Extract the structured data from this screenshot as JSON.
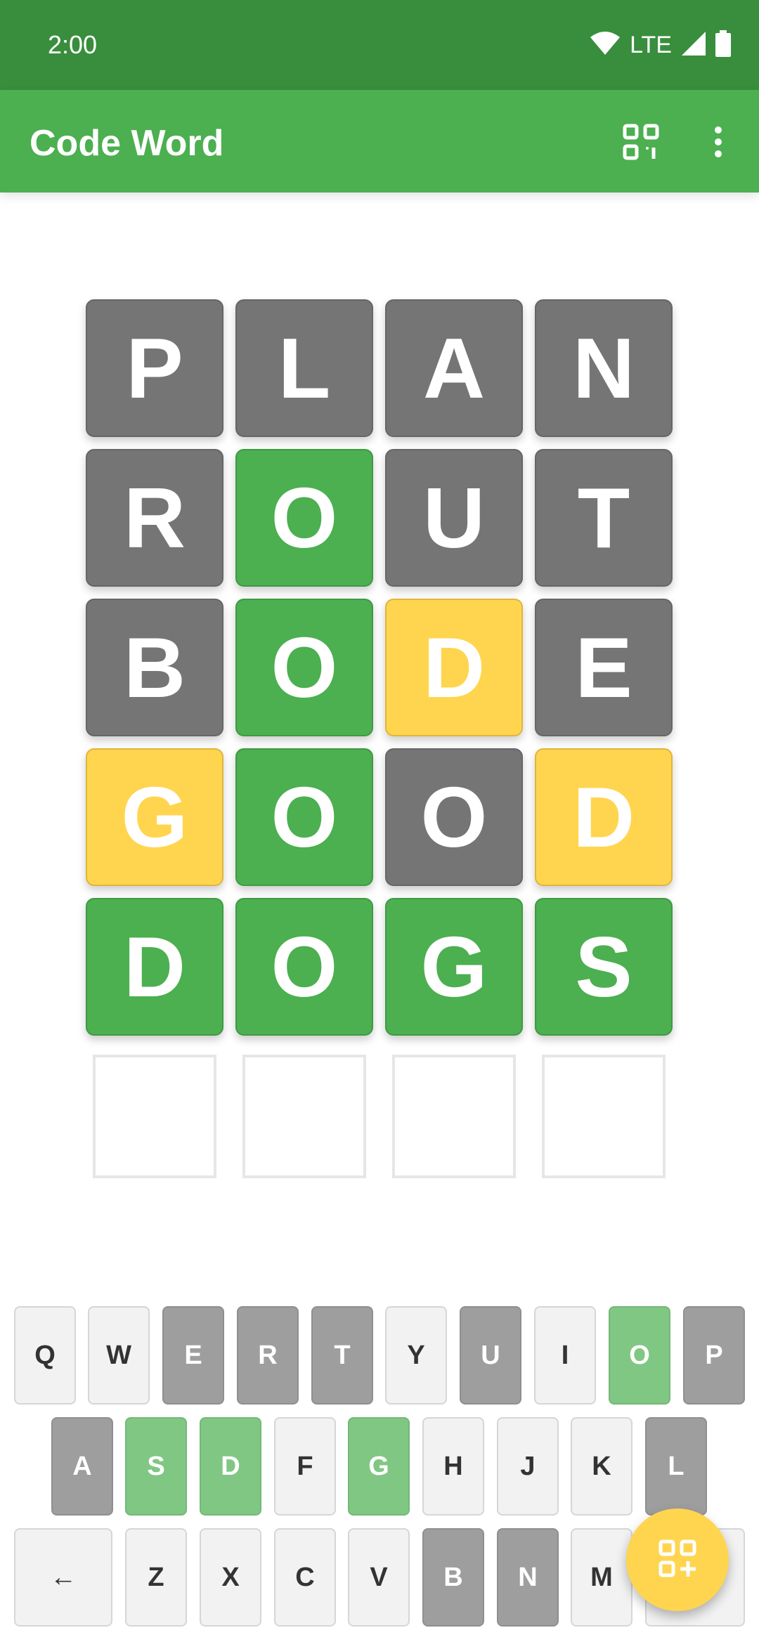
{
  "status_bar": {
    "time": "2:00",
    "network": "LTE",
    "icons": [
      "wifi-icon",
      "cell-signal-icon",
      "battery-icon"
    ]
  },
  "app_bar": {
    "title": "Code Word",
    "actions": [
      "grid-view-icon",
      "more-vert-icon"
    ]
  },
  "board": {
    "rows": [
      [
        {
          "letter": "P",
          "state": "absent"
        },
        {
          "letter": "L",
          "state": "absent"
        },
        {
          "letter": "A",
          "state": "absent"
        },
        {
          "letter": "N",
          "state": "absent"
        }
      ],
      [
        {
          "letter": "R",
          "state": "absent"
        },
        {
          "letter": "O",
          "state": "correct"
        },
        {
          "letter": "U",
          "state": "absent"
        },
        {
          "letter": "T",
          "state": "absent"
        }
      ],
      [
        {
          "letter": "B",
          "state": "absent"
        },
        {
          "letter": "O",
          "state": "correct"
        },
        {
          "letter": "D",
          "state": "present"
        },
        {
          "letter": "E",
          "state": "absent"
        }
      ],
      [
        {
          "letter": "G",
          "state": "present"
        },
        {
          "letter": "O",
          "state": "correct"
        },
        {
          "letter": "O",
          "state": "absent"
        },
        {
          "letter": "D",
          "state": "present"
        }
      ],
      [
        {
          "letter": "D",
          "state": "correct"
        },
        {
          "letter": "O",
          "state": "correct"
        },
        {
          "letter": "G",
          "state": "correct"
        },
        {
          "letter": "S",
          "state": "correct"
        }
      ]
    ],
    "empty_row_count": 4
  },
  "keyboard": {
    "row1": [
      {
        "label": "Q",
        "state": "default"
      },
      {
        "label": "W",
        "state": "default"
      },
      {
        "label": "E",
        "state": "absent"
      },
      {
        "label": "R",
        "state": "absent"
      },
      {
        "label": "T",
        "state": "absent"
      },
      {
        "label": "Y",
        "state": "default"
      },
      {
        "label": "U",
        "state": "absent"
      },
      {
        "label": "I",
        "state": "default"
      },
      {
        "label": "O",
        "state": "correct"
      },
      {
        "label": "P",
        "state": "absent"
      }
    ],
    "row2": [
      {
        "label": "A",
        "state": "absent"
      },
      {
        "label": "S",
        "state": "correct"
      },
      {
        "label": "D",
        "state": "correct"
      },
      {
        "label": "F",
        "state": "default"
      },
      {
        "label": "G",
        "state": "correct"
      },
      {
        "label": "H",
        "state": "default"
      },
      {
        "label": "J",
        "state": "default"
      },
      {
        "label": "K",
        "state": "default"
      },
      {
        "label": "L",
        "state": "absent"
      }
    ],
    "row3": [
      {
        "label": "←",
        "state": "default",
        "role": "backspace"
      },
      {
        "label": "Z",
        "state": "default"
      },
      {
        "label": "X",
        "state": "default"
      },
      {
        "label": "C",
        "state": "default"
      },
      {
        "label": "V",
        "state": "default"
      },
      {
        "label": "B",
        "state": "absent"
      },
      {
        "label": "N",
        "state": "absent"
      },
      {
        "label": "M",
        "state": "default"
      }
    ]
  },
  "fab": {
    "icon": "add-grid-icon"
  },
  "colors": {
    "status_bar": "#388e3c",
    "app_bar": "#4caf50",
    "correct": "#4caf50",
    "present": "#ffd54f",
    "absent": "#757575",
    "key_correct": "#81c784",
    "key_absent": "#9e9e9e",
    "key_default": "#f2f2f2"
  }
}
